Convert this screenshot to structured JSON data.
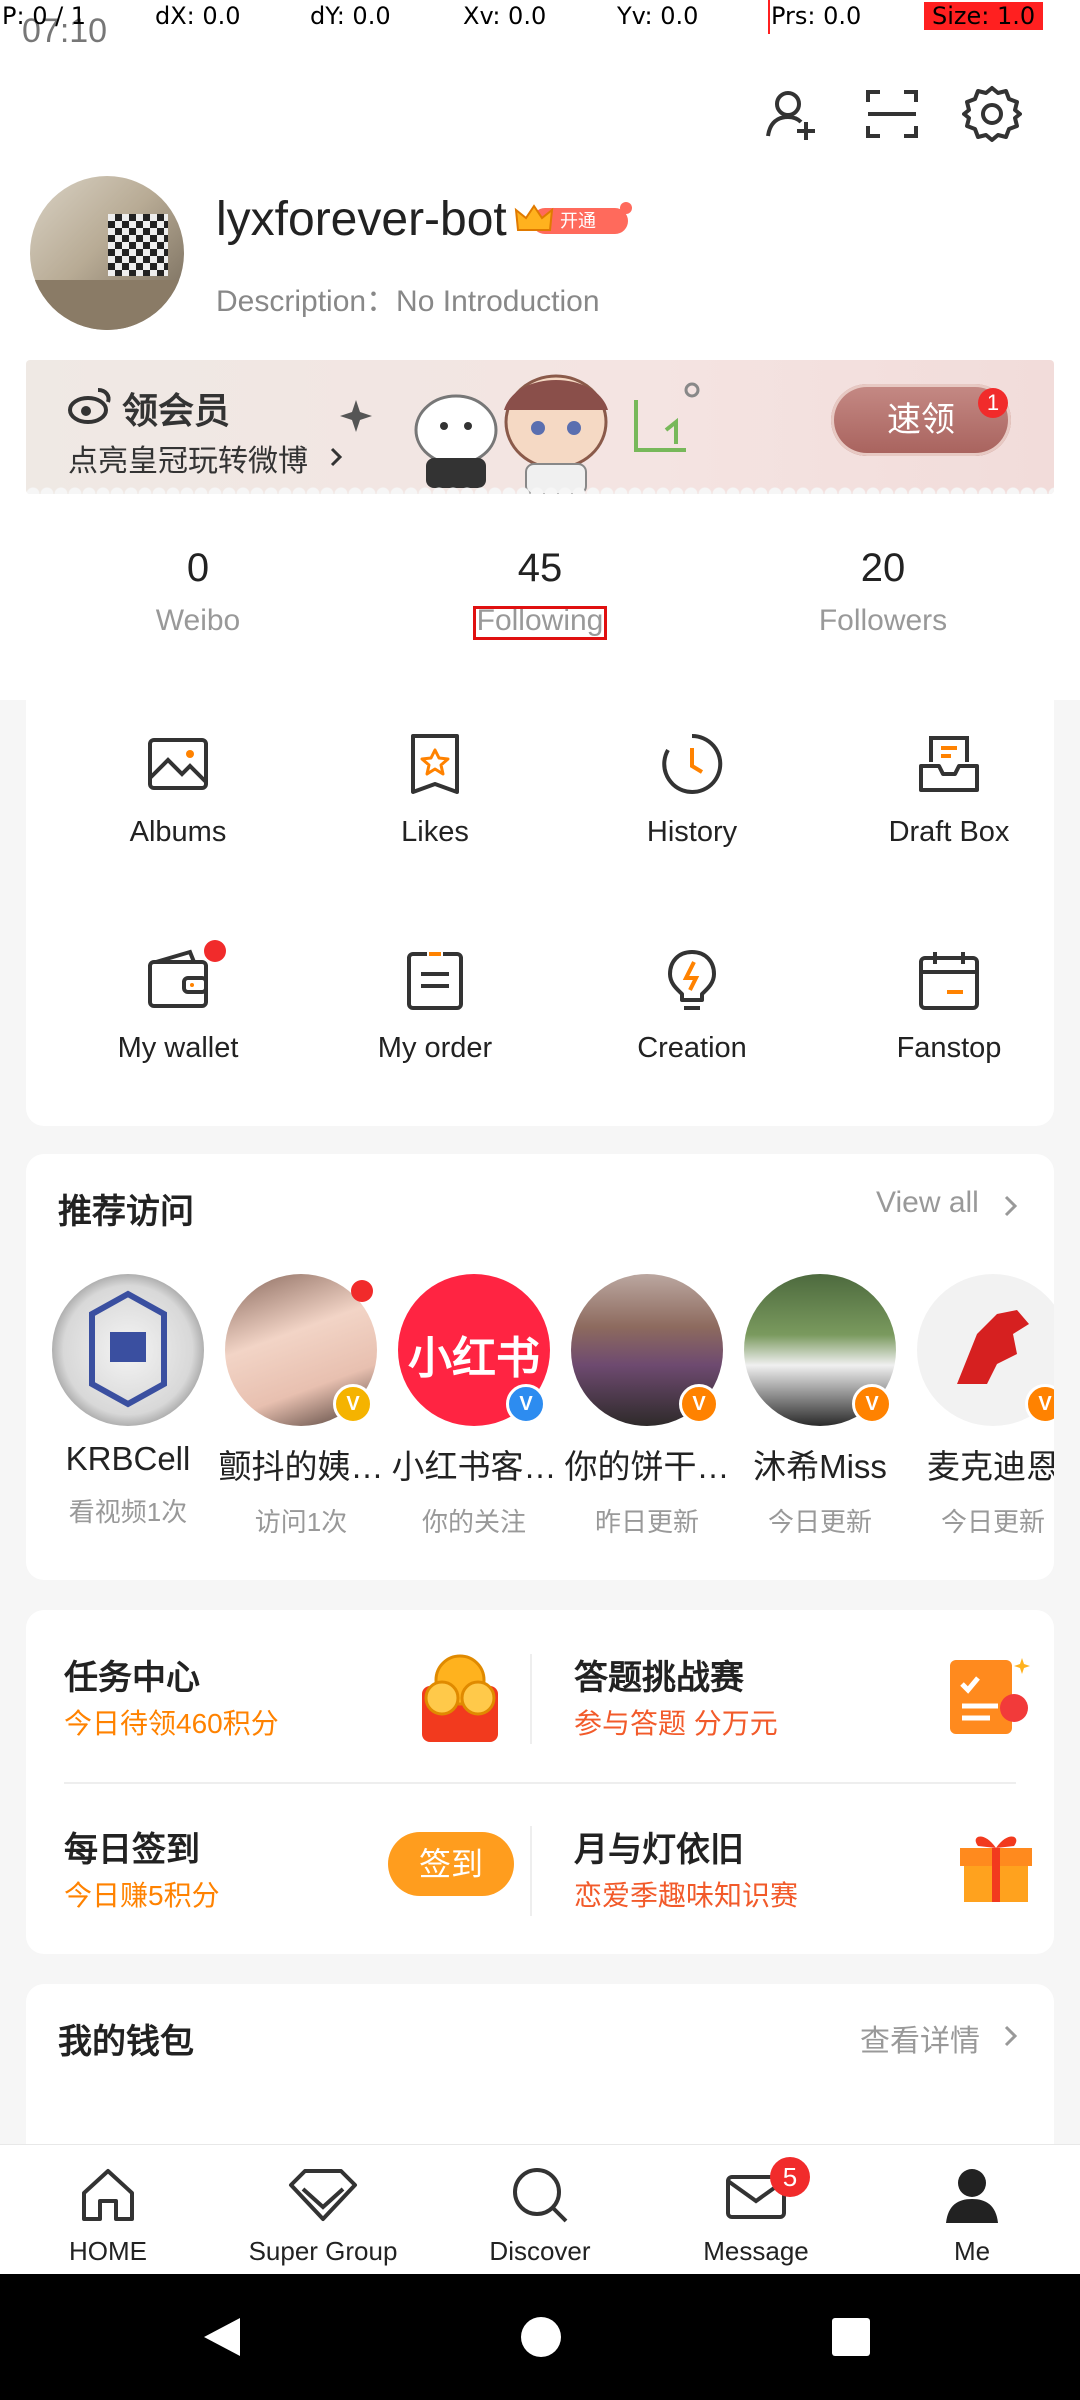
{
  "debug": {
    "p": "P: 0 / 1",
    "dx": "dX: 0.0",
    "dy": "dY: 0.0",
    "xv": "Xv: 0.0",
    "yv": "Yv: 0.0",
    "prs": "Prs: 0.0",
    "size": "Size: 1.0"
  },
  "status": {
    "time": "07:10"
  },
  "profile": {
    "username": "lyxforever-bot",
    "vip_badge": "开通",
    "description": "Description：No Introduction"
  },
  "banner": {
    "title": "领会员",
    "subtitle": "点亮皇冠玩转微博",
    "button": "速领",
    "badge_count": "1"
  },
  "stats": [
    {
      "value": "0",
      "label": "Weibo"
    },
    {
      "value": "45",
      "label": "Following"
    },
    {
      "value": "20",
      "label": "Followers"
    }
  ],
  "tools": [
    {
      "label": "Albums",
      "icon": "image-icon"
    },
    {
      "label": "Likes",
      "icon": "star-bookmark-icon"
    },
    {
      "label": "History",
      "icon": "clock-icon"
    },
    {
      "label": "Draft Box",
      "icon": "inbox-icon"
    },
    {
      "label": "My wallet",
      "icon": "wallet-icon"
    },
    {
      "label": "My order",
      "icon": "order-list-icon"
    },
    {
      "label": "Creation",
      "icon": "lightbulb-icon"
    },
    {
      "label": "Fanstop",
      "icon": "calendar-icon"
    }
  ],
  "recommend": {
    "title": "推荐访问",
    "view_all": "View all",
    "items": [
      {
        "name": "KRBCell",
        "sub": "看视频1次"
      },
      {
        "name": "颤抖的姨…",
        "sub": "访问1次"
      },
      {
        "name": "小红书客…",
        "sub": "你的关注",
        "logo_text": "小红书"
      },
      {
        "name": "你的饼干…",
        "sub": "昨日更新"
      },
      {
        "name": "沐希Miss",
        "sub": "今日更新"
      },
      {
        "name": "麦克迪恩",
        "sub": "今日更新"
      }
    ]
  },
  "tasks": {
    "task_center": {
      "title": "任务中心",
      "sub": "今日待领460积分"
    },
    "quiz": {
      "title": "答题挑战赛",
      "sub": "参与答题 分万元"
    },
    "checkin": {
      "title": "每日签到",
      "sub": "今日赚5积分",
      "button": "签到"
    },
    "lantern": {
      "title": "月与灯依旧",
      "sub": "恋爱季趣味知识赛"
    }
  },
  "wallet": {
    "title": "我的钱包",
    "details": "查看详情"
  },
  "nav": {
    "items": [
      {
        "label": "HOME",
        "icon": "home-icon"
      },
      {
        "label": "Super Group",
        "icon": "diamond-icon"
      },
      {
        "label": "Discover",
        "icon": "search-icon"
      },
      {
        "label": "Message",
        "icon": "mail-icon"
      },
      {
        "label": "Me",
        "icon": "person-icon"
      }
    ],
    "message_badge": "5"
  },
  "colors": {
    "accent": "#ff8200",
    "highlight": "#e01010",
    "badge": "#f12b2b"
  }
}
